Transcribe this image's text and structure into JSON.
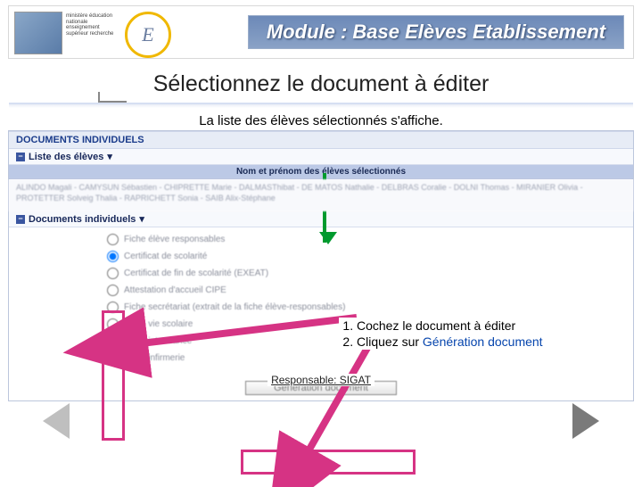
{
  "banner": {
    "logo_letter": "E",
    "small_text": "ministère éducation nationale enseignement supérieur recherche",
    "module_title": "Module : Base Elèves Etablissement"
  },
  "page_title": "Sélectionnez le document à éditer",
  "caption": "La liste des élèves sélectionnés s'affiche.",
  "app": {
    "section_head": "DOCUMENTS INDIVIDUELS",
    "list_row": "Liste des élèves",
    "names_header": "Nom et prénom des élèves sélectionnés",
    "names_body": "ALINDO Magali - CAMYSUN Sébastien - CHIPRETTE Marie - DALMASThibat - DE MATOS Nathalie - DELBRAS Coralie - DOLNI Thomas - MIRANIER Olivia - PROTETTER Solveig Thalia - RAPRICHETT Sonia - SAIB Alix-Stéphane",
    "docs_row": "Documents individuels",
    "docs": [
      {
        "label": "Fiche élève responsables",
        "checked": false
      },
      {
        "label": "Certificat de scolarité",
        "checked": true
      },
      {
        "label": "Certificat de fin de scolarité (EXEAT)",
        "checked": false
      },
      {
        "label": "Attestation d'accueil CIPE",
        "checked": false
      },
      {
        "label": "Fiche secrétariat (extrait de la fiche élève-responsables)",
        "checked": false
      },
      {
        "label": "Fiche vie scolaire",
        "checked": false
      },
      {
        "label": "Fiche intendance",
        "checked": false
      },
      {
        "label": "Fiche infirmerie",
        "checked": false
      }
    ],
    "responsible_label": "Responsable: SIGAT",
    "gen_button": "Génération document"
  },
  "instructions": {
    "item1_num": "1.",
    "item1_text": "Cochez le document à éditer",
    "item2_num": "2.",
    "item2_prefix": "Cliquez sur ",
    "item2_link": "Génération document"
  }
}
